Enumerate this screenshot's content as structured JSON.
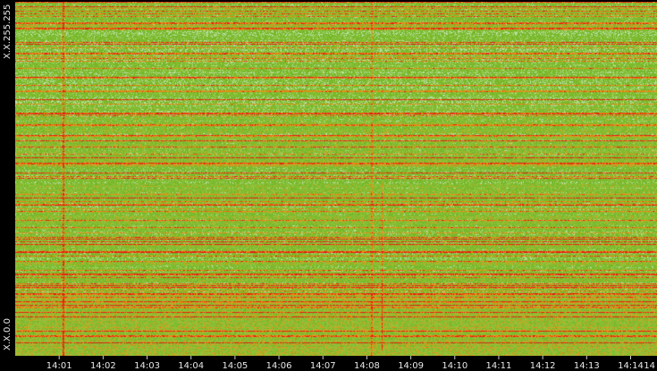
{
  "chart_data": {
    "type": "heatmap",
    "title": "",
    "xlabel": "",
    "ylabel": "",
    "y_axis": {
      "top_label": "X.X.255.255",
      "bottom_label": "X.X.0.0"
    },
    "x_ticks": [
      "14:01",
      "14:02",
      "14:03",
      "14:04",
      "14:05",
      "14:06",
      "14:07",
      "14:08",
      "14:09",
      "14:10",
      "14:11",
      "14:12",
      "14:13",
      "14:14",
      "14"
    ],
    "x_range_minutes": [
      0.0,
      14.6
    ],
    "tick_minutes": [
      1,
      2,
      3,
      4,
      5,
      6,
      7,
      8,
      9,
      10,
      11,
      12,
      13,
      14,
      15
    ],
    "colors": {
      "background": "#000000",
      "low": "#76b82a",
      "mid_low": "#8fc23a",
      "mid": "#d2a21e",
      "high": "#f07b12",
      "peak": "#e81e0e",
      "light": "#b8e0a0"
    },
    "grid": false,
    "legend": "none"
  }
}
